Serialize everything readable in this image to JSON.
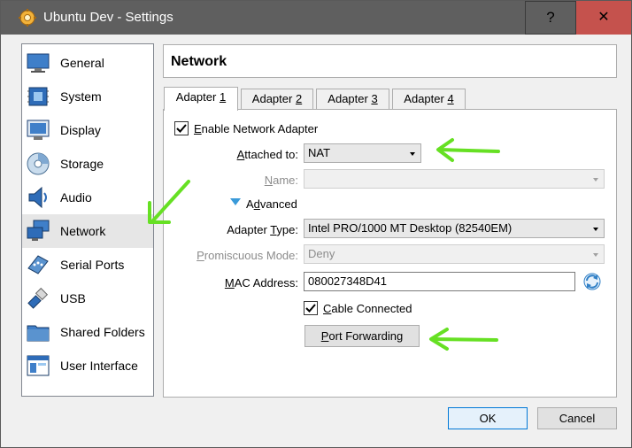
{
  "window": {
    "title": "Ubuntu Dev - Settings",
    "help_label": "?",
    "close_label": "✕"
  },
  "sidebar": {
    "items": [
      {
        "label": "General",
        "icon": "monitor-icon"
      },
      {
        "label": "System",
        "icon": "chip-icon"
      },
      {
        "label": "Display",
        "icon": "display-icon"
      },
      {
        "label": "Storage",
        "icon": "disk-icon"
      },
      {
        "label": "Audio",
        "icon": "speaker-icon"
      },
      {
        "label": "Network",
        "icon": "network-icon",
        "selected": true
      },
      {
        "label": "Serial Ports",
        "icon": "serial-port-icon"
      },
      {
        "label": "USB",
        "icon": "usb-icon"
      },
      {
        "label": "Shared Folders",
        "icon": "folder-icon"
      },
      {
        "label": "User Interface",
        "icon": "window-icon"
      }
    ]
  },
  "header": {
    "title": "Network"
  },
  "tabs": [
    {
      "prefix": "Adapter ",
      "key": "1",
      "active": true
    },
    {
      "prefix": "Adapter ",
      "key": "2"
    },
    {
      "prefix": "Adapter ",
      "key": "3"
    },
    {
      "prefix": "Adapter ",
      "key": "4"
    }
  ],
  "adapter": {
    "enable_label_key": "E",
    "enable_label_rest": "nable Network Adapter",
    "enable_checked": true,
    "attached_to_label_key": "A",
    "attached_to_label_rest": "ttached to:",
    "attached_to_value": "NAT",
    "name_label_key": "N",
    "name_label_rest": "ame:",
    "name_value": "",
    "advanced_label_prefix": "A",
    "advanced_label_key": "d",
    "advanced_label_rest": "vanced",
    "adapter_type_label_prefix": "Adapter ",
    "adapter_type_label_key": "T",
    "adapter_type_label_rest": "ype:",
    "adapter_type_value": "Intel PRO/1000 MT Desktop (82540EM)",
    "promiscuous_label_key": "P",
    "promiscuous_label_rest": "romiscuous Mode:",
    "promiscuous_value": "Deny",
    "mac_label_key": "M",
    "mac_label_rest": "AC Address:",
    "mac_value": "080027348D41",
    "cable_label_key": "C",
    "cable_label_rest": "able Connected",
    "cable_checked": true,
    "port_forwarding_key": "P",
    "port_forwarding_rest": "ort Forwarding"
  },
  "footer": {
    "ok_label": "OK",
    "cancel_label": "Cancel"
  },
  "colors": {
    "annotation_arrow": "#66e023",
    "accent": "#0078d7",
    "close": "#c5524d"
  }
}
